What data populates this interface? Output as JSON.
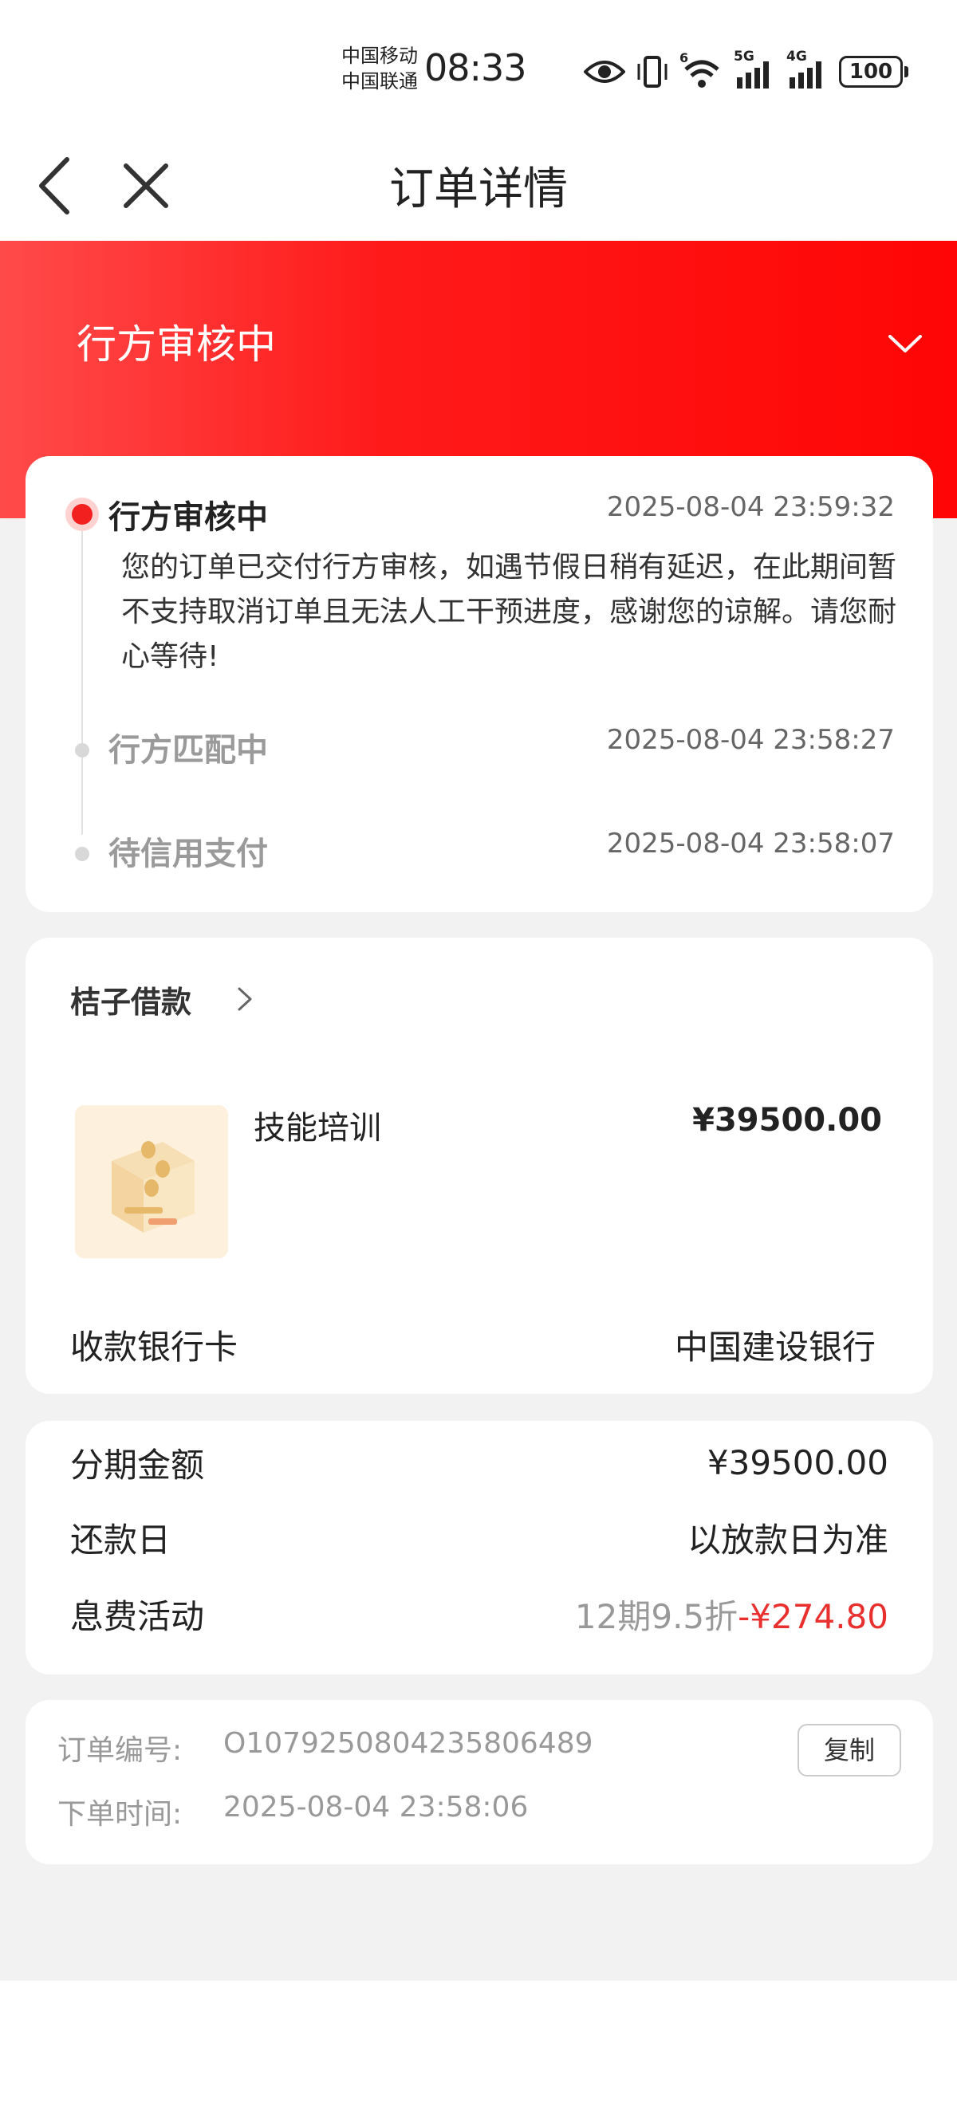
{
  "status_bar": {
    "carrier_1": "中国移动",
    "carrier_2": "中国联通",
    "time": "08:33",
    "battery": "100",
    "network_1": "5G",
    "network_2": "4G",
    "wifi_badge": "6",
    "icons": [
      "eye-icon",
      "vibrate-icon",
      "wifi-icon",
      "signal-icon",
      "signal-icon",
      "battery-icon"
    ]
  },
  "nav": {
    "title": "订单详情",
    "back_icon": "chevron-left-icon",
    "close_icon": "close-icon"
  },
  "banner": {
    "status_title": "行方审核中",
    "toggle_icon": "chevron-down-icon",
    "gradient_colors": [
      "#ff4a4a",
      "#ff0505"
    ]
  },
  "timeline": [
    {
      "title": "行方审核中",
      "time": "2025-08-04 23:59:32",
      "description": "您的订单已交付行方审核，如遇节假日稍有延迟，在此期间暂不支持取消订单且无法人工干预进度，感谢您的谅解。请您耐心等待!"
    },
    {
      "title": "行方匹配中",
      "time": "2025-08-04 23:58:27"
    },
    {
      "title": "待信用支付",
      "time": "2025-08-04 23:58:07"
    }
  ],
  "product_card": {
    "merchant": "桔子借款",
    "product_name": "技能培训",
    "product_price": "¥39500.00",
    "bank_label": "收款银行卡",
    "bank_value": "中国建设银行"
  },
  "plan": {
    "amount_label": "分期金额",
    "amount_value": "¥39500.00",
    "repay_label": "还款日",
    "repay_value": "以放款日为准",
    "promo_label": "息费活动",
    "promo_gray": "12期9.5折",
    "promo_red": "-¥274.80"
  },
  "order": {
    "number_label": "订单编号:",
    "number_value": "O107925080423580648​9",
    "time_label": "下单时间:",
    "time_value": "2025-08-04 23:58:06",
    "copy_label": "复制"
  },
  "colors": {
    "accent_red": "#f32020",
    "discount_red": "#e8302f"
  }
}
